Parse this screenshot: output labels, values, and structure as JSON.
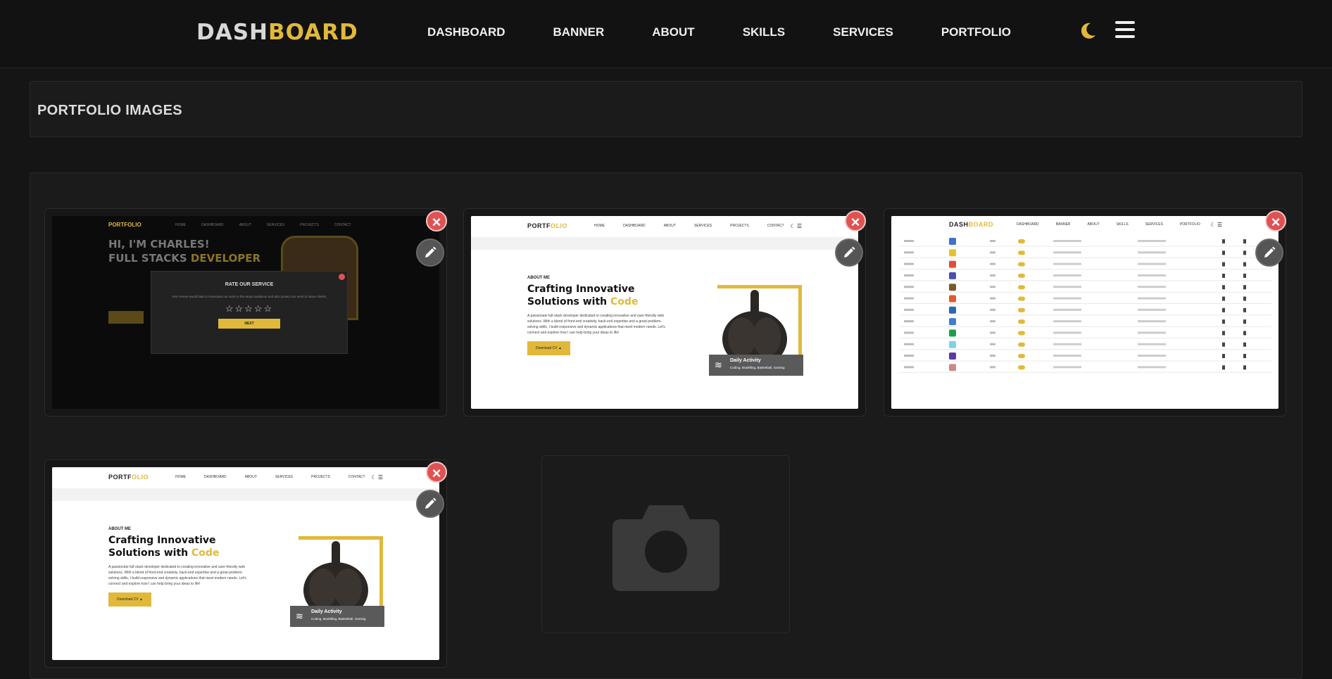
{
  "nav": {
    "logo_a": "DASH",
    "logo_b": "BOARD",
    "links": [
      "DASHBOARD",
      "BANNER",
      "ABOUT",
      "SKILLS",
      "SERVICES",
      "PORTFOLIO"
    ]
  },
  "header": {
    "title": "PORTFOLIO IMAGES"
  },
  "gallery": {
    "close_label": "×",
    "shot1": {
      "logo": "PORTFOLIO",
      "links": [
        "HOME",
        "DASHBOARD",
        "ABOUT",
        "SERVICES",
        "PROJECTS",
        "CONTACT"
      ],
      "hero_line1": "HI, I'M CHARLES!",
      "hero_line2a": "FULL STACKS",
      "hero_line2b": "DEVELOPER",
      "modal_title": "RATE OUR SERVICE",
      "modal_text": "Your review would help to showcase our work to the target audience and also protect our work to future clients.",
      "stars": "☆☆☆☆☆",
      "next": "NEXT"
    },
    "shot_about": {
      "logo_a": "PORTF",
      "logo_b": "OLIO",
      "links": [
        "HOME",
        "DASHBOARD",
        "ABOUT",
        "SERVICES",
        "PROJECTS",
        "CONTACT"
      ],
      "tag": "ABOUT ME",
      "h1": "Crafting Innovative",
      "h2a": "Solutions with",
      "h2b": "Code",
      "p": "A passionate full-stack developer dedicated to creating innovative and user-friendly web solutions. With a blend of front-end creativity, back-end expertise and a great problem-solving skills, I build responsive and dynamic applications that meet modern needs. Let's connect and explore how I can help bring your ideas to life!",
      "btn": "Download CV ▲",
      "activity_title": "Daily Activity",
      "activity_sub": "Coding, Modelling, Basketball, Gaming"
    },
    "shot_table": {
      "logo_a": "DASH",
      "logo_b": "BOARD",
      "links": [
        "DASHBOARD",
        "BANNER",
        "ABOUT",
        "SKILLS",
        "SERVICES",
        "PORTFOLIO"
      ]
    }
  }
}
